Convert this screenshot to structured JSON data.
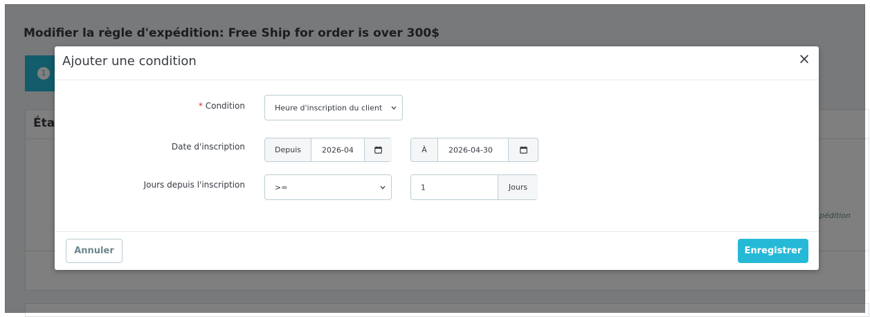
{
  "background": {
    "page_title": "Modifier la règle d'expédition: Free Ship for order is over 300$",
    "step_number": "1",
    "card_heading": "Éta",
    "side_text": "pédition"
  },
  "modal": {
    "title": "Ajouter une condition",
    "close_label": "×",
    "fields": {
      "condition": {
        "required_mark": "*",
        "label": "Condition",
        "selected": "Heure d'inscription du client"
      },
      "registration_date": {
        "label": "Date d'inscription",
        "from_addon": "Depuis",
        "from_value": "2026-04",
        "to_addon": "À",
        "to_value": "2026-04-30"
      },
      "days_since": {
        "label": "Jours depuis l'inscription",
        "operator": ">=",
        "value": "1",
        "unit": "Jours"
      }
    },
    "cancel_label": "Annuler",
    "save_label": "Enregistrer"
  },
  "colors": {
    "accent": "#25b9d7",
    "required": "#e2242b",
    "text": "#363a41",
    "border": "#bbcdd2"
  },
  "icons": [
    "close-icon",
    "chevron-down-icon",
    "calendar-icon"
  ]
}
